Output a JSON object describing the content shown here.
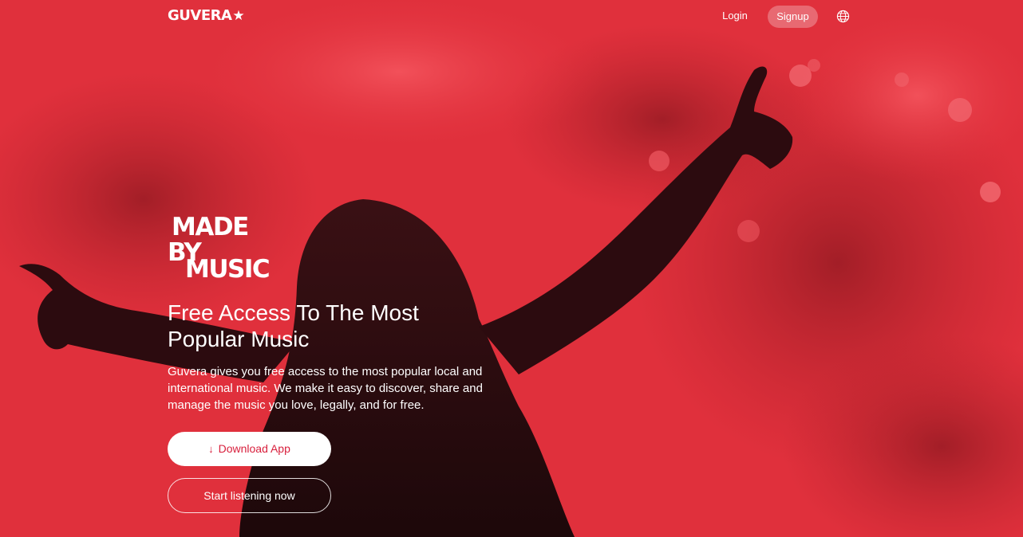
{
  "header": {
    "logo_text": "GUVERA",
    "logo_star": "★",
    "login_label": "Login",
    "signup_label": "Signup",
    "language_icon": "globe-icon"
  },
  "hero": {
    "tagline_lines": [
      "MADE",
      "BY",
      "MUSIC"
    ],
    "headline": "Free Access To The Most Popular Music",
    "description": "Guvera gives you free access to the most popular local and international music. We make it easy to discover, share and manage the music you love, legally, and for free.",
    "download_icon": "arrow-down-icon",
    "download_label": "Download App",
    "listen_label": "Start listening now",
    "background_image": "concert-crowd-silhouette-photo"
  },
  "colors": {
    "brand_red": "#e2323d",
    "silhouette": "#2a0c10",
    "text": "#ffffff",
    "button_text": "#d81f3c"
  }
}
